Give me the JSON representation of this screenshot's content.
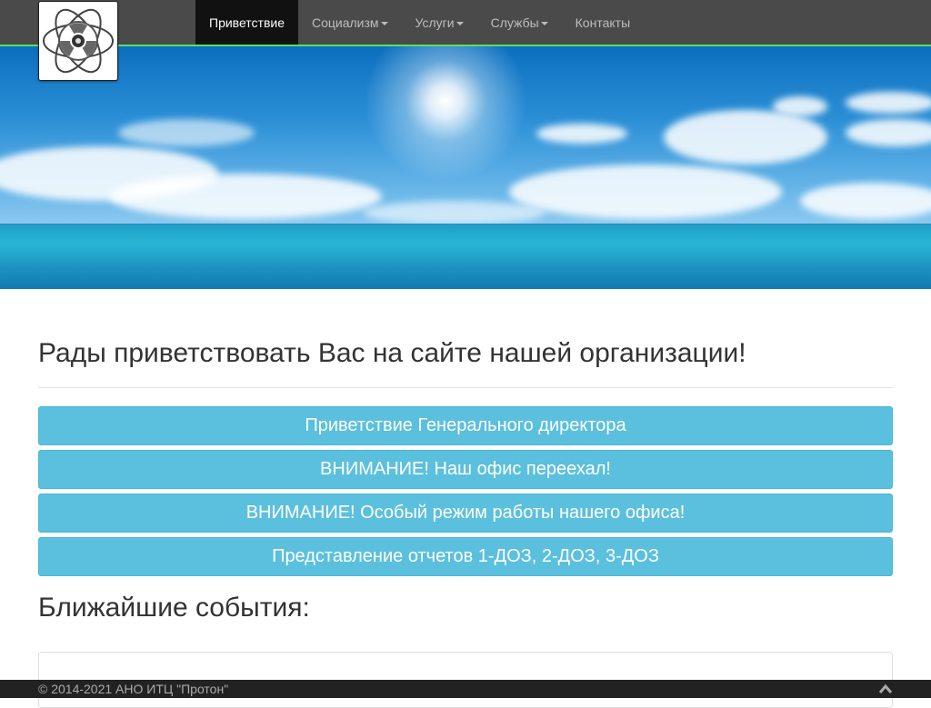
{
  "brand": {
    "logo_icon": "atom-radiation-icon"
  },
  "nav": {
    "items": [
      {
        "label": "Приветствие",
        "active": true,
        "dropdown": false
      },
      {
        "label": "Социализм",
        "active": false,
        "dropdown": true
      },
      {
        "label": "Услуги",
        "active": false,
        "dropdown": true
      },
      {
        "label": "Службы",
        "active": false,
        "dropdown": true
      },
      {
        "label": "Контакты",
        "active": false,
        "dropdown": false
      }
    ]
  },
  "hero": {
    "image": "sky-sea-banner"
  },
  "main": {
    "heading": "Рады приветствовать Вас на сайте нашей организации!",
    "buttons": [
      {
        "label": "Приветствие Генерального директора"
      },
      {
        "label": "ВНИМАНИЕ! Наш офис переехал!"
      },
      {
        "label": "ВНИМАНИЕ! Особый режим работы нашего офиса!"
      },
      {
        "label": "Представление отчетов 1-ДОЗ, 2-ДОЗ, 3-ДОЗ"
      }
    ],
    "events_heading": "Ближайшие события:"
  },
  "footer": {
    "copyright": "© 2014-2021 АНО ИТЦ \"Протон\"",
    "up_icon": "chevron-up-icon"
  },
  "colors": {
    "navbar_bg": "#4a4a4a",
    "navbar_accent": "#5ce05c",
    "nav_active_bg": "#111111",
    "button_bg": "#5bc0de",
    "footer_bg": "#222222"
  }
}
